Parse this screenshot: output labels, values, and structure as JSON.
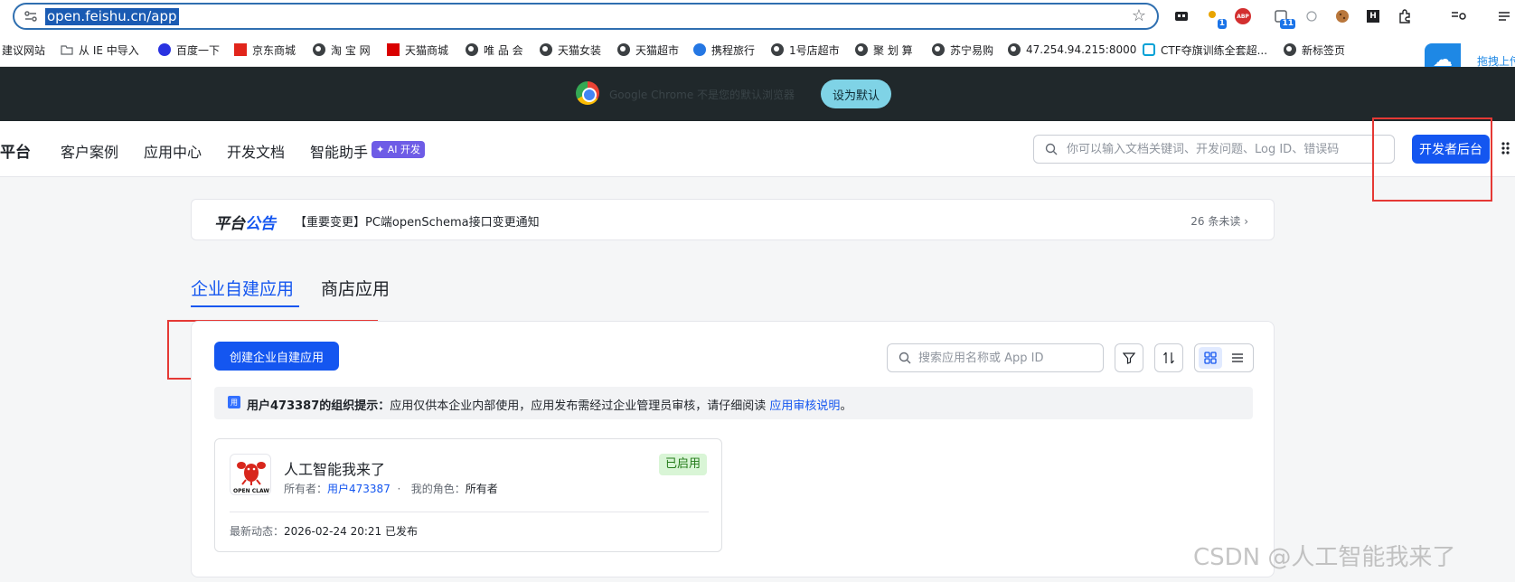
{
  "browser": {
    "url": "open.feishu.cn/app",
    "ext_badge_1": "1",
    "ext_abp": "ABP",
    "ext_badge_2": "11",
    "ext_h": "H"
  },
  "bookmarks": [
    {
      "label": "建议网站"
    },
    {
      "label": "从 IE 中导入"
    },
    {
      "label": "百度一下"
    },
    {
      "label": "京东商城"
    },
    {
      "label": "淘 宝 网"
    },
    {
      "label": "天猫商城"
    },
    {
      "label": "唯 品 会"
    },
    {
      "label": "天猫女装"
    },
    {
      "label": "天猫超市"
    },
    {
      "label": "携程旅行"
    },
    {
      "label": "1号店超市"
    },
    {
      "label": "聚 划 算"
    },
    {
      "label": "苏宁易购"
    },
    {
      "label": "47.254.94.215:8000"
    },
    {
      "label": "CTF夺旗训练全套超..."
    },
    {
      "label": "新标签页"
    }
  ],
  "cloud_tool": {
    "label": "拖拽上传"
  },
  "default_bar": {
    "text": "Google Chrome 不是您的默认浏览器",
    "button": "设为默认"
  },
  "header": {
    "brand": "平台",
    "nav": [
      "客户案例",
      "应用中心",
      "开发文档",
      "智能助手"
    ],
    "ai_tag": "✦ AI 开发",
    "search_placeholder": "你可以输入文档关键词、开发问题、Log ID、错误码",
    "dev_button": "开发者后台"
  },
  "announcement": {
    "title_a": "平台",
    "title_b": "公告",
    "message": "【重要变更】PC端openSchema接口变更通知",
    "unread": "26 条未读 ›"
  },
  "tabs": [
    "企业自建应用",
    "商店应用"
  ],
  "panel": {
    "create_button": "创建企业自建应用",
    "search_placeholder": "搜索应用名称或 App ID",
    "tip_icon": "用",
    "tip_bold": "用户473387的组织提示：",
    "tip_text": "应用仅供本企业内部使用，应用发布需经过企业管理员审核，请仔细阅读 ",
    "tip_link": "应用审核说明",
    "tip_end": "。"
  },
  "app_card": {
    "logo_text": "OPEN CLAW",
    "name": "人工智能我来了",
    "status": "已启用",
    "owner_label": "所有者：",
    "owner": "用户473387",
    "sep": "·",
    "role_label": "我的角色：",
    "role": "所有者",
    "latest_label": "最新动态：",
    "latest_value": "2026-02-24 20:21 已发布"
  },
  "watermark": "CSDN @人工智能我来了"
}
